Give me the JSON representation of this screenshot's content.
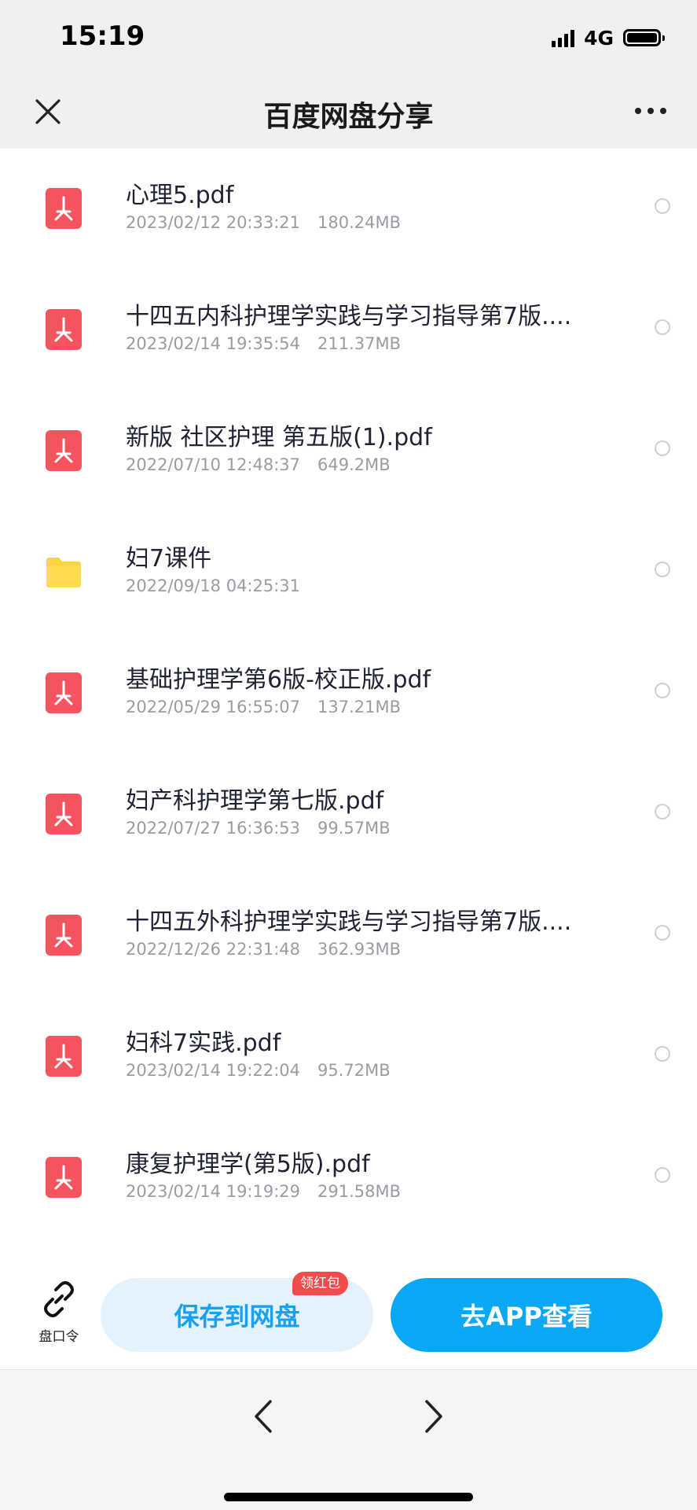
{
  "status_bar": {
    "time": "15:19",
    "network": "4G"
  },
  "nav": {
    "title": "百度网盘分享",
    "close_icon": "close-icon",
    "more_icon": "more-horizontal-icon"
  },
  "files": [
    {
      "name": "心理5.pdf",
      "date": "2023/02/12 20:33:21",
      "size": "180.24MB",
      "type": "pdf"
    },
    {
      "name": "十四五内科护理学实践与学习指导第7版....",
      "date": "2023/02/14 19:35:54",
      "size": "211.37MB",
      "type": "pdf"
    },
    {
      "name": "新版 社区护理 第五版(1).pdf",
      "date": "2022/07/10 12:48:37",
      "size": "649.2MB",
      "type": "pdf"
    },
    {
      "name": "妇7课件",
      "date": "2022/09/18 04:25:31",
      "size": "",
      "type": "folder"
    },
    {
      "name": "基础护理学第6版-校正版.pdf",
      "date": "2022/05/29 16:55:07",
      "size": "137.21MB",
      "type": "pdf"
    },
    {
      "name": "妇产科护理学第七版.pdf",
      "date": "2022/07/27 16:36:53",
      "size": "99.57MB",
      "type": "pdf"
    },
    {
      "name": "十四五外科护理学实践与学习指导第7版....",
      "date": "2022/12/26 22:31:48",
      "size": "362.93MB",
      "type": "pdf"
    },
    {
      "name": "妇科7实践.pdf",
      "date": "2023/02/14 19:22:04",
      "size": "95.72MB",
      "type": "pdf"
    },
    {
      "name": "康复护理学(第5版).pdf",
      "date": "2023/02/14 19:19:29",
      "size": "291.58MB",
      "type": "pdf"
    }
  ],
  "actions": {
    "passcode_label": "盘口令",
    "save_label": "保存到网盘",
    "redpacket_badge": "领红包",
    "open_app_label": "去APP查看"
  },
  "colors": {
    "pdf_icon": "#f5545f",
    "folder_icon": "#fdd33e",
    "accent": "#0aa7f5",
    "save_bg": "#e4f2fd"
  }
}
